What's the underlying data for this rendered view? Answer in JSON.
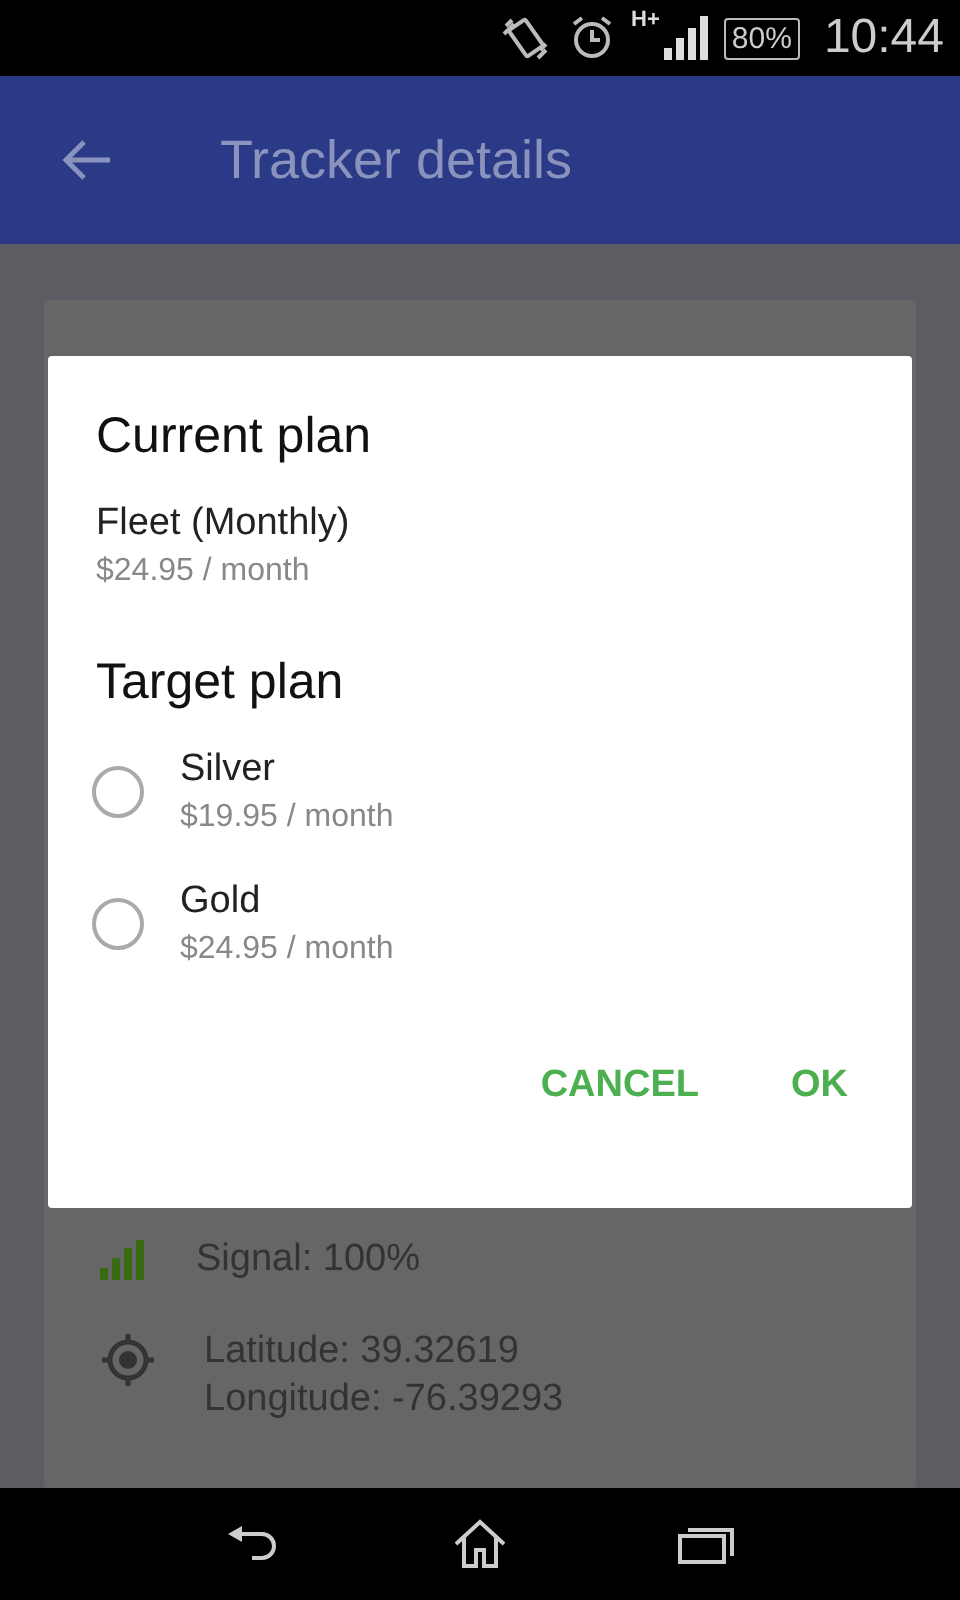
{
  "status_bar": {
    "network": "H+",
    "battery": "80%",
    "time": "10:44"
  },
  "app_bar": {
    "title": "Tracker details"
  },
  "details": [
    {
      "kind": "signal",
      "lines": [
        "Signal: 100%"
      ]
    },
    {
      "kind": "location",
      "lines": [
        "Latitude: 39.32619",
        "Longitude: -76.39293"
      ]
    }
  ],
  "dialog": {
    "current_title": "Current plan",
    "current_plan": {
      "name": "Fleet (Monthly)",
      "price": "$24.95 / month"
    },
    "target_title": "Target plan",
    "options": [
      {
        "name": "Silver",
        "price": "$19.95 / month",
        "selected": false
      },
      {
        "name": "Gold",
        "price": "$24.95 / month",
        "selected": false
      }
    ],
    "buttons": [
      "CANCEL",
      "OK"
    ]
  }
}
